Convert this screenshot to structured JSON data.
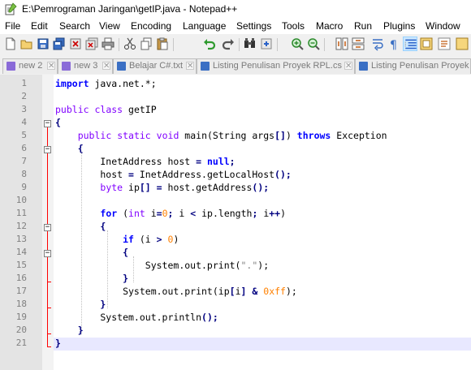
{
  "window": {
    "title": "E:\\Pemrograman Jaringan\\getIP.java - Notepad++"
  },
  "menu": [
    "File",
    "Edit",
    "Search",
    "View",
    "Encoding",
    "Language",
    "Settings",
    "Tools",
    "Macro",
    "Run",
    "Plugins",
    "Window"
  ],
  "toolbar": [
    "new-file-icon",
    "open-file-icon",
    "save-icon",
    "save-all-icon",
    "close-icon",
    "close-all-icon",
    "print-icon",
    "cut-icon",
    "copy-icon",
    "paste-icon",
    "undo-icon",
    "redo-icon",
    "find-icon",
    "replace-icon",
    "zoom-in-icon",
    "zoom-out-icon",
    "sync-vertical-icon",
    "sync-horizontal-icon",
    "word-wrap-icon",
    "show-all-characters-icon",
    "indent-guide-icon",
    "document-map-icon",
    "function-list-icon"
  ],
  "tabs": [
    {
      "label": "new 2"
    },
    {
      "label": "new 3"
    },
    {
      "label": "Belajar C#.txt"
    },
    {
      "label": "Listing Penulisan Proyek RPL.cs"
    },
    {
      "label": "Listing Penulisan Proyek R"
    }
  ],
  "editor": {
    "line_numbers": [
      "1",
      "2",
      "3",
      "4",
      "5",
      "6",
      "7",
      "8",
      "9",
      "10",
      "11",
      "12",
      "13",
      "14",
      "15",
      "16",
      "17",
      "18",
      "19",
      "20",
      "21"
    ],
    "lines": [
      [
        [
          "kw",
          "import"
        ],
        [
          "plain",
          " java.net.*;"
        ]
      ],
      [],
      [
        [
          "kw2",
          "public"
        ],
        [
          "plain",
          " "
        ],
        [
          "kw2",
          "class"
        ],
        [
          "plain",
          " getIP"
        ]
      ],
      [
        [
          "op",
          "{"
        ]
      ],
      [
        [
          "plain",
          "    "
        ],
        [
          "kw2",
          "public"
        ],
        [
          "plain",
          " "
        ],
        [
          "kw2",
          "static"
        ],
        [
          "plain",
          " "
        ],
        [
          "kw2",
          "void"
        ],
        [
          "plain",
          " main(String args"
        ],
        [
          "op",
          "[]"
        ],
        [
          "plain",
          ") "
        ],
        [
          "kw",
          "throws"
        ],
        [
          "plain",
          " Exception"
        ]
      ],
      [
        [
          "plain",
          "    "
        ],
        [
          "op",
          "{"
        ]
      ],
      [
        [
          "plain",
          "        InetAddress host "
        ],
        [
          "op",
          "="
        ],
        [
          "plain",
          " "
        ],
        [
          "kw",
          "null"
        ],
        [
          "op",
          ";"
        ]
      ],
      [
        [
          "plain",
          "        host "
        ],
        [
          "op",
          "="
        ],
        [
          "plain",
          " InetAddress.getLocalHost"
        ],
        [
          "op",
          "();"
        ]
      ],
      [
        [
          "plain",
          "        "
        ],
        [
          "kw2",
          "byte"
        ],
        [
          "plain",
          " ip"
        ],
        [
          "op",
          "[]"
        ],
        [
          "plain",
          " "
        ],
        [
          "op",
          "="
        ],
        [
          "plain",
          " host.getAddress"
        ],
        [
          "op",
          "();"
        ]
      ],
      [],
      [
        [
          "plain",
          "        "
        ],
        [
          "kw",
          "for"
        ],
        [
          "plain",
          " ("
        ],
        [
          "kw2",
          "int"
        ],
        [
          "plain",
          " i"
        ],
        [
          "op",
          "="
        ],
        [
          "num",
          "0"
        ],
        [
          "op",
          ";"
        ],
        [
          "plain",
          " i "
        ],
        [
          "op",
          "<"
        ],
        [
          "plain",
          " ip.length"
        ],
        [
          "op",
          ";"
        ],
        [
          "plain",
          " i"
        ],
        [
          "op",
          "++"
        ],
        [
          "plain",
          ")"
        ]
      ],
      [
        [
          "plain",
          "        "
        ],
        [
          "op",
          "{"
        ]
      ],
      [
        [
          "plain",
          "            "
        ],
        [
          "kw",
          "if"
        ],
        [
          "plain",
          " (i "
        ],
        [
          "op",
          ">"
        ],
        [
          "plain",
          " "
        ],
        [
          "num",
          "0"
        ],
        [
          "plain",
          ")"
        ]
      ],
      [
        [
          "plain",
          "            "
        ],
        [
          "op",
          "{"
        ]
      ],
      [
        [
          "plain",
          "                System.out.print("
        ],
        [
          "str",
          "\".\""
        ],
        [
          "plain",
          ");"
        ]
      ],
      [
        [
          "plain",
          "            "
        ],
        [
          "op",
          "}"
        ]
      ],
      [
        [
          "plain",
          "            System.out.print(ip"
        ],
        [
          "op",
          "["
        ],
        [
          "plain",
          "i"
        ],
        [
          "op",
          "]"
        ],
        [
          "plain",
          " "
        ],
        [
          "op",
          "&"
        ],
        [
          "plain",
          " "
        ],
        [
          "num",
          "0xff"
        ],
        [
          "plain",
          ");"
        ]
      ],
      [
        [
          "plain",
          "        "
        ],
        [
          "op",
          "}"
        ]
      ],
      [
        [
          "plain",
          "        System.out.println"
        ],
        [
          "op",
          "();"
        ]
      ],
      [
        [
          "plain",
          "    "
        ],
        [
          "op",
          "}"
        ]
      ],
      [
        [
          "op",
          "}"
        ]
      ]
    ]
  }
}
